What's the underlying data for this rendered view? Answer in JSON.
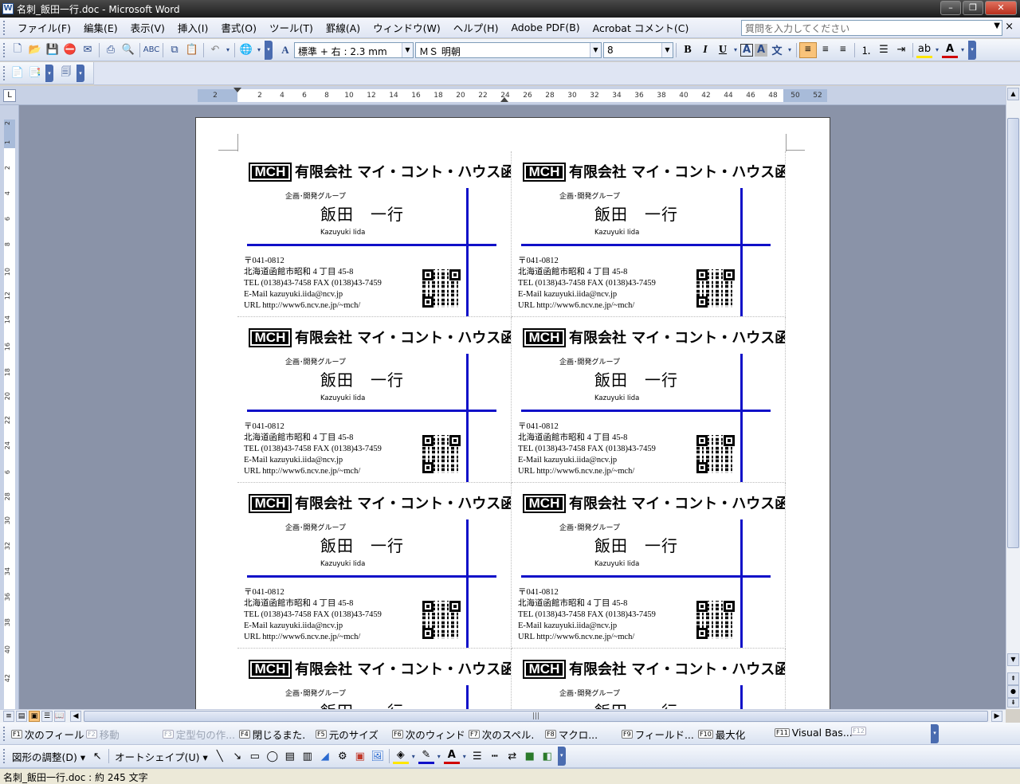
{
  "window": {
    "title": "名刺_飯田一行.doc - Microsoft Word",
    "app_icon": "W",
    "minimize": "–",
    "restore": "❐",
    "close": "✕"
  },
  "menu": {
    "items": [
      "ファイル(F)",
      "編集(E)",
      "表示(V)",
      "挿入(I)",
      "書式(O)",
      "ツール(T)",
      "罫線(A)",
      "ウィンドウ(W)",
      "ヘルプ(H)",
      "Adobe PDF(B)",
      "Acrobat コメント(C)"
    ],
    "help_placeholder": "質問を入力してください",
    "close_doc": "×"
  },
  "formatting": {
    "style": "標準 + 右 :  2.3 mm",
    "font": "ＭＳ 明朝",
    "size": "8",
    "bold": "B",
    "italic": "I",
    "underline": "U"
  },
  "ruler": {
    "corner": "L",
    "ticks": [
      "2",
      "2",
      "4",
      "6",
      "8",
      "10",
      "12",
      "14",
      "16",
      "18",
      "20",
      "22",
      "24",
      "26",
      "28",
      "30",
      "32",
      "34",
      "36",
      "38",
      "40",
      "42",
      "44",
      "46",
      "48",
      "50",
      "52"
    ],
    "vticks": [
      "2",
      "1",
      "2",
      "4",
      "6",
      "8",
      "10",
      "12",
      "14",
      "16",
      "18",
      "20",
      "22",
      "24",
      "6",
      "28",
      "30",
      "32",
      "34",
      "36",
      "38",
      "40",
      "42"
    ]
  },
  "card": {
    "logo": "MCH",
    "company": "有限会社 マイ・コント・ハウス函館",
    "department": "企画･開発グループ",
    "name": "飯田　一行",
    "romaji": "Kazuyuki Iida",
    "postal": "〒041-0812",
    "address": "北海道函館市昭和 4 丁目 45-8",
    "tel": "TEL (0138)43-7458     FAX (0138)43-7459",
    "email": "E-Mail kazuyuki.iida@ncv.jp",
    "url": "URL http://www6.ncv.ne.jp/~mch/",
    "line_color": "#1010c8"
  },
  "fkeys": [
    {
      "key": "F1",
      "label": "次のフィール",
      "enabled": true
    },
    {
      "key": "F2",
      "label": "移動",
      "enabled": false
    },
    {
      "key": "F3",
      "label": "定型句の作...",
      "enabled": false
    },
    {
      "key": "F4",
      "label": "閉じるまた.",
      "enabled": true
    },
    {
      "key": "F5",
      "label": "元のサイズ",
      "enabled": true
    },
    {
      "key": "F6",
      "label": "次のウィンド",
      "enabled": true
    },
    {
      "key": "F7",
      "label": "次のスペル.",
      "enabled": true
    },
    {
      "key": "F8",
      "label": "マクロ...",
      "enabled": true
    },
    {
      "key": "F9",
      "label": "フィールド...",
      "enabled": true
    },
    {
      "key": "F10",
      "label": "最大化",
      "enabled": true
    },
    {
      "key": "F11",
      "label": "Visual Bas...",
      "enabled": true
    },
    {
      "key": "F12",
      "label": "",
      "enabled": false
    }
  ],
  "drawing": {
    "adjust": "図形の調整(D)",
    "autoshape": "オートシェイプ(U)"
  },
  "status": {
    "text": "名刺_飯田一行.doc : 約 245 文字"
  },
  "scroll": {
    "up": "▲",
    "down": "▼",
    "grip": "|||"
  }
}
